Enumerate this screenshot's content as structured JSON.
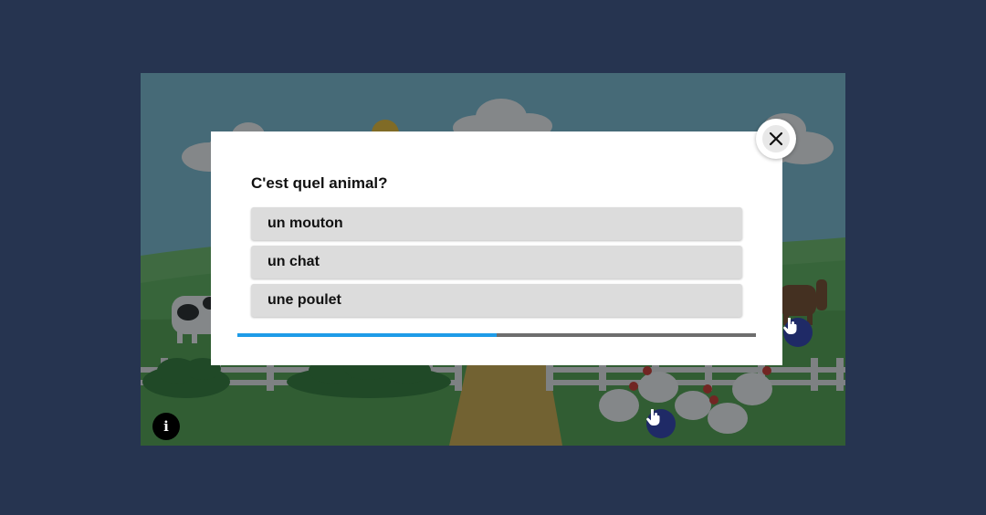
{
  "quiz": {
    "question": "C'est quel animal?",
    "options": [
      "un mouton",
      "un chat",
      "une poulet"
    ],
    "progress": 0.5
  },
  "icons": {
    "close": "close-icon",
    "info": "info-icon",
    "info_glyph": "i",
    "hotspot": "hand-pointer-icon"
  },
  "colors": {
    "page_background": "#263450",
    "progress_fill": "#1e9be8",
    "progress_track": "#6e6e6e",
    "option_background": "#dcdcdc",
    "hotspot": "#1f2a66"
  }
}
